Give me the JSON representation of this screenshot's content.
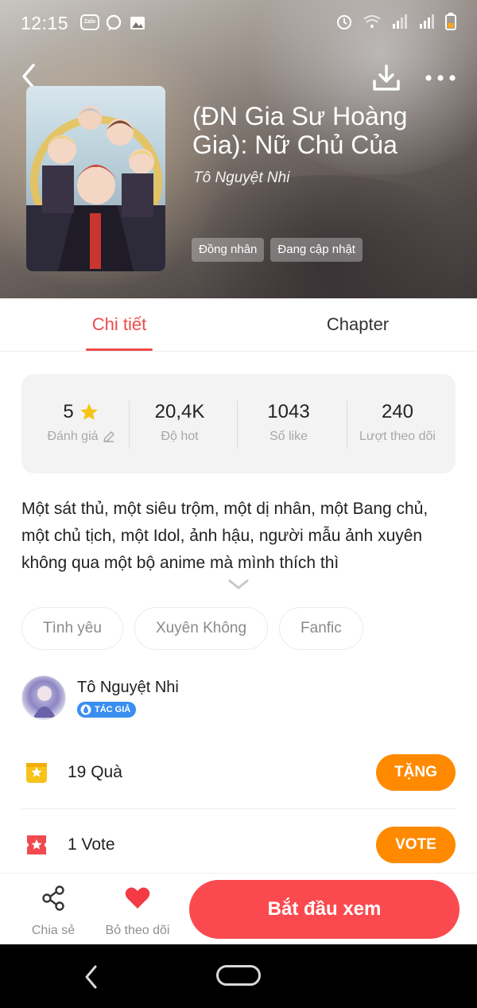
{
  "status_bar": {
    "time": "12:15",
    "zalo_label": "Zalo"
  },
  "header": {
    "title": "(ĐN Gia Sư Hoàng Gia): Nữ Chủ Của",
    "author": "Tô Nguyệt Nhi",
    "genres": [
      "Đồng nhân",
      "Đang cập nhật"
    ]
  },
  "tabs": {
    "detail": "Chi tiết",
    "chapter": "Chapter",
    "active": "detail"
  },
  "stats": {
    "rating": {
      "value": "5",
      "label": "Đánh giá"
    },
    "hot": {
      "value": "20,4K",
      "label": "Độ hot"
    },
    "likes": {
      "value": "1043",
      "label": "Số like"
    },
    "followers": {
      "value": "240",
      "label": "Lượt theo dõi"
    }
  },
  "description": "Một sát thủ, một siêu trộm, một dị nhân, một Bang chủ, một chủ tịch, một Idol, ảnh hậu, người mẫu ảnh xuyên không qua một bộ anime mà mình thích thì",
  "tags": [
    "Tình yêu",
    "Xuyên Không",
    "Fanfic"
  ],
  "author_card": {
    "name": "Tô Nguyệt Nhi",
    "badge": "TÁC GIẢ"
  },
  "gift": {
    "count_label": "19  Quà",
    "button": "TẶNG"
  },
  "vote": {
    "count_label": "1  Vote",
    "button": "VOTE"
  },
  "bottom_actions": {
    "share": "Chia sẻ",
    "unfollow": "Bỏ theo dõi",
    "start": "Bắt đầu xem"
  },
  "colors": {
    "accent_red": "#ef4a4a",
    "primary_button": "#fb4a4f",
    "orange_button": "#ff8a00",
    "badge_blue": "#3a8ef0",
    "star_yellow": "#f5c518"
  }
}
